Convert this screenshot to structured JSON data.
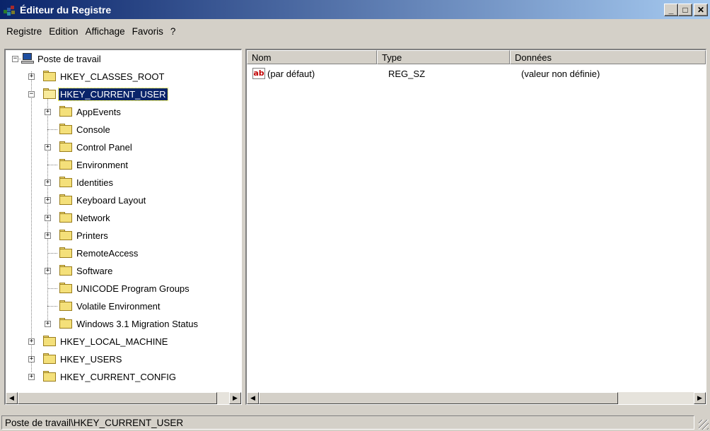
{
  "window": {
    "title": "Éditeur du Registre",
    "minimize_icon": "_",
    "maximize_icon": "□",
    "close_icon": "✕"
  },
  "menu": [
    "Registre",
    "Edition",
    "Affichage",
    "Favoris",
    "?"
  ],
  "tree": {
    "root": "Poste de travail",
    "hives": [
      {
        "label": "HKEY_CLASSES_ROOT",
        "expander": "+"
      },
      {
        "label": "HKEY_CURRENT_USER",
        "expander": "−",
        "selected": true
      },
      {
        "label": "HKEY_LOCAL_MACHINE",
        "expander": "+"
      },
      {
        "label": "HKEY_USERS",
        "expander": "+"
      },
      {
        "label": "HKEY_CURRENT_CONFIG",
        "expander": "+"
      }
    ],
    "current_user_children": [
      {
        "label": "AppEvents",
        "expander": "+"
      },
      {
        "label": "Console",
        "expander": ""
      },
      {
        "label": "Control Panel",
        "expander": "+"
      },
      {
        "label": "Environment",
        "expander": ""
      },
      {
        "label": "Identities",
        "expander": "+"
      },
      {
        "label": "Keyboard Layout",
        "expander": "+"
      },
      {
        "label": "Network",
        "expander": "+"
      },
      {
        "label": "Printers",
        "expander": "+"
      },
      {
        "label": "RemoteAccess",
        "expander": ""
      },
      {
        "label": "Software",
        "expander": "+"
      },
      {
        "label": "UNICODE Program Groups",
        "expander": ""
      },
      {
        "label": "Volatile Environment",
        "expander": ""
      },
      {
        "label": "Windows 3.1 Migration Status",
        "expander": "+"
      }
    ]
  },
  "list": {
    "columns": [
      "Nom",
      "Type",
      "Données"
    ],
    "rows": [
      {
        "icon": "ab",
        "name": "(par défaut)",
        "type": "REG_SZ",
        "data": "(valeur non définie)"
      }
    ]
  },
  "scroll": {
    "left": "◀",
    "right": "▶"
  },
  "status": {
    "path": "Poste de travail\\HKEY_CURRENT_USER"
  },
  "colors": {
    "titlebar_start": "#0a246a",
    "titlebar_end": "#a6caf0",
    "selection": "#0a246a",
    "face": "#d4d0c8"
  }
}
